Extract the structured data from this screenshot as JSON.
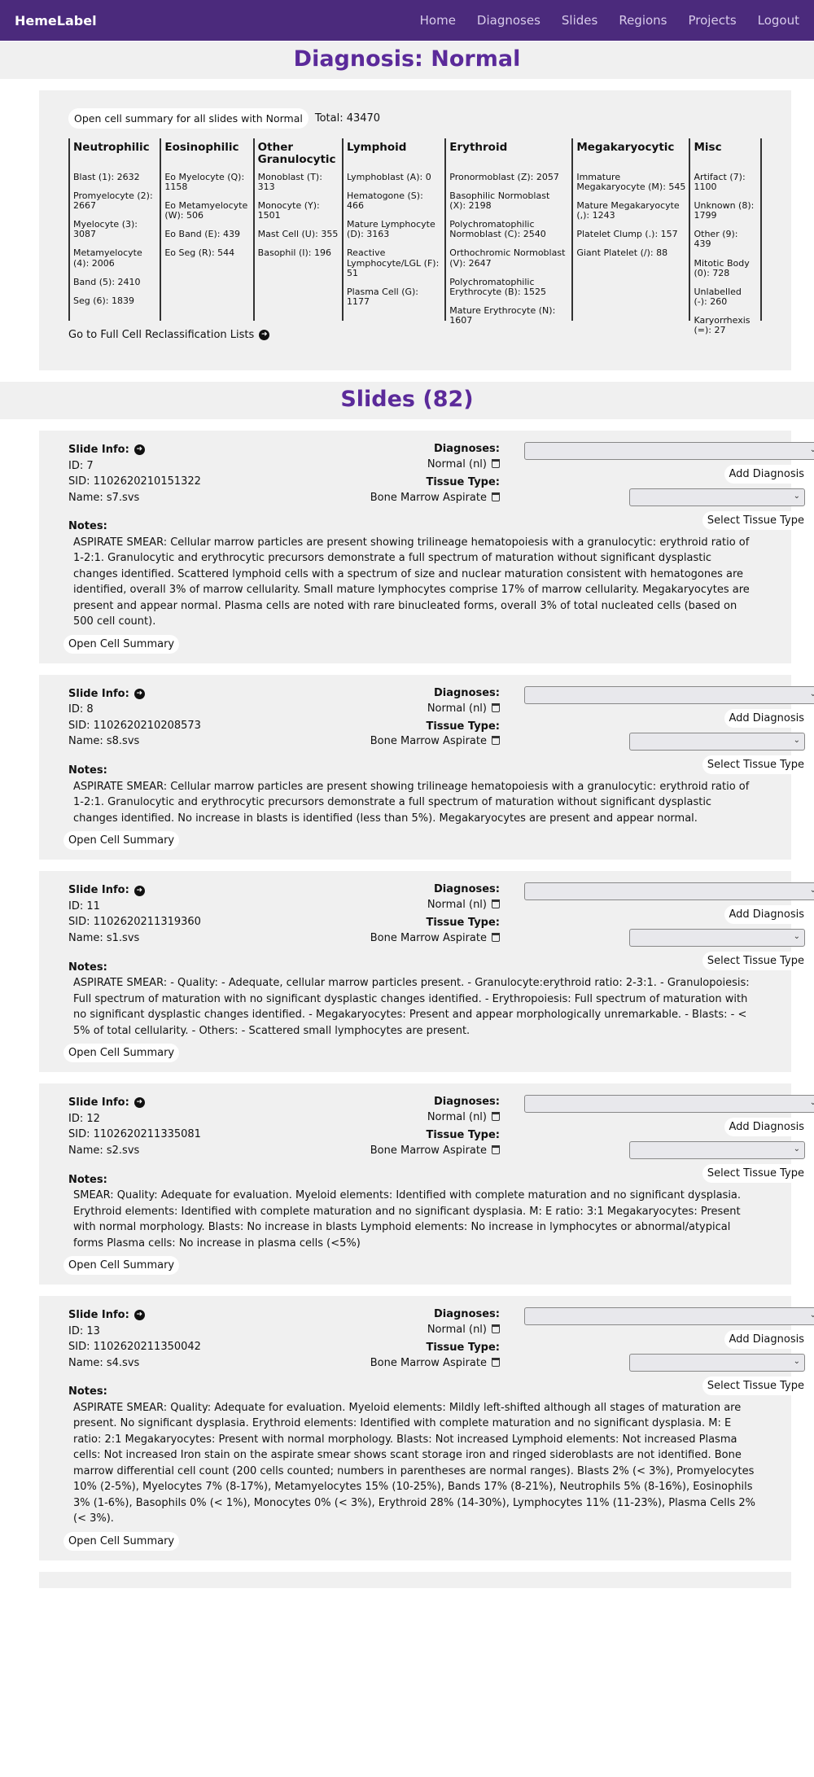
{
  "nav": {
    "brand": "HemeLabel",
    "links": [
      "Home",
      "Diagnoses",
      "Slides",
      "Regions",
      "Projects",
      "Logout"
    ]
  },
  "header": {
    "title": "Diagnosis: Normal"
  },
  "summary": {
    "open_button": "Open cell summary for all slides with Normal",
    "total": "Total: 43470",
    "columns": [
      {
        "title": "Neutrophilic",
        "items": [
          "Blast (1): 2632",
          "Promyelocyte (2): 2667",
          "Myelocyte (3): 3087",
          "Metamyelocyte (4): 2006",
          "Band (5): 2410",
          "Seg (6): 1839"
        ]
      },
      {
        "title": "Eosinophilic",
        "items": [
          "Eo Myelocyte (Q): 1158",
          "Eo Metamyelocyte (W): 506",
          "Eo Band (E): 439",
          "Eo Seg (R): 544"
        ]
      },
      {
        "title": "Other Granulocytic",
        "items": [
          "Monoblast (T): 313",
          "Monocyte (Y): 1501",
          "Mast Cell (U): 355",
          "Basophil (I): 196"
        ]
      },
      {
        "title": "Lymphoid",
        "items": [
          "Lymphoblast (A): 0",
          "Hematogone (S): 466",
          "Mature Lymphocyte (D): 3163",
          "Reactive Lymphocyte/LGL (F): 51",
          "Plasma Cell (G): 1177"
        ]
      },
      {
        "title": "Erythroid",
        "items": [
          "Pronormoblast (Z): 2057",
          "Basophilic Normoblast (X): 2198",
          "Polychromatophilic Normoblast (C): 2540",
          "Orthochromic Normoblast (V): 2647",
          "Polychromatophilic Erythrocyte (B): 1525",
          "Mature Erythrocyte (N): 1607"
        ]
      },
      {
        "title": "Megakaryocytic",
        "items": [
          "Immature Megakaryocyte (M): 545",
          "Mature Megakaryocyte (,): 1243",
          "Platelet Clump (.): 157",
          "Giant Platelet (/): 88"
        ]
      },
      {
        "title": "Misc",
        "items": [
          "Artifact (7): 1100",
          "Unknown (8): 1799",
          "Other (9): 439",
          "Mitotic Body (0): 728",
          "Unlabelled (-): 260",
          "Karyorrhexis (=): 27"
        ]
      }
    ],
    "full_link": "Go to Full Cell Reclassification Lists"
  },
  "slides_header": {
    "title": "Slides (82)"
  },
  "labels": {
    "slide_info": "Slide Info:",
    "diagnoses": "Diagnoses:",
    "tissue_type": "Tissue Type:",
    "add_diagnosis": "Add Diagnosis",
    "select_tissue": "Select Tissue Type",
    "notes": "Notes:",
    "open_cell_summary": "Open Cell Summary"
  },
  "slides": [
    {
      "id": "ID: 7",
      "sid": "SID: 1102620210151322",
      "name": "Name: s7.svs",
      "diagnosis": "Normal (nl)",
      "tissue": "Bone Marrow Aspirate",
      "notes": "ASPIRATE SMEAR: Cellular marrow particles are present showing trilineage hematopoiesis with a granulocytic: erythroid ratio of 1-2:1. Granulocytic and erythrocytic precursors demonstrate a full spectrum of maturation without significant dysplastic changes identified. Scattered lymphoid cells with a spectrum of size and nuclear maturation consistent with hematogones are identified, overall 3% of marrow cellularity. Small mature lymphocytes comprise 17% of marrow cellularity. Megakaryocytes are present and appear normal. Plasma cells are noted with rare binucleated forms, overall 3% of total nucleated cells (based on 500 cell count)."
    },
    {
      "id": "ID: 8",
      "sid": "SID: 1102620210208573",
      "name": "Name: s8.svs",
      "diagnosis": "Normal (nl)",
      "tissue": "Bone Marrow Aspirate",
      "notes": "ASPIRATE SMEAR: Cellular marrow particles are present showing trilineage hematopoiesis with a granulocytic: erythroid ratio of 1-2:1. Granulocytic and erythrocytic precursors demonstrate a full spectrum of maturation without significant dysplastic changes identified. No increase in blasts is identified (less than 5%). Megakaryocytes are present and appear normal."
    },
    {
      "id": "ID: 11",
      "sid": "SID: 1102620211319360",
      "name": "Name: s1.svs",
      "diagnosis": "Normal (nl)",
      "tissue": "Bone Marrow Aspirate",
      "notes": "ASPIRATE SMEAR: - Quality: - Adequate, cellular marrow particles present. - Granulocyte:erythroid ratio: 2-3:1. - Granulopoiesis: Full spectrum of maturation with no significant dysplastic changes identified. - Erythropoiesis: Full spectrum of maturation with no significant dysplastic changes identified. - Megakaryocytes: Present and appear morphologically unremarkable. - Blasts: - < 5% of total cellularity. - Others: - Scattered small lymphocytes are present."
    },
    {
      "id": "ID: 12",
      "sid": "SID: 1102620211335081",
      "name": "Name: s2.svs",
      "diagnosis": "Normal (nl)",
      "tissue": "Bone Marrow Aspirate",
      "notes": "SMEAR: Quality: Adequate for evaluation. Myeloid elements: Identified with complete maturation and no significant dysplasia. Erythroid elements: Identified with complete maturation and no significant dysplasia. M: E ratio: 3:1 Megakaryocytes: Present with normal morphology. Blasts: No increase in blasts Lymphoid elements: No increase in lymphocytes or abnormal/atypical forms Plasma cells: No increase in plasma cells (<5%)"
    },
    {
      "id": "ID: 13",
      "sid": "SID: 1102620211350042",
      "name": "Name: s4.svs",
      "diagnosis": "Normal (nl)",
      "tissue": "Bone Marrow Aspirate",
      "notes": "ASPIRATE SMEAR: Quality: Adequate for evaluation. Myeloid elements: Mildly left-shifted although all stages of maturation are present. No significant dysplasia. Erythroid elements: Identified with complete maturation and no significant dysplasia. M: E ratio: 2:1 Megakaryocytes: Present with normal morphology. Blasts: Not increased Lymphoid elements: Not increased Plasma cells: Not increased Iron stain on the aspirate smear shows scant storage iron and ringed sideroblasts are not identified. Bone marrow differential cell count (200 cells counted; numbers in parentheses are normal ranges). Blasts 2% (< 3%), Promyelocytes 10% (2-5%), Myelocytes 7% (8-17%), Metamyelocytes 15% (10-25%), Bands 17% (8-21%), Neutrophils 5% (8-16%), Eosinophils 3% (1-6%), Basophils 0% (< 1%), Monocytes 0% (< 3%), Erythroid 28% (14-30%), Lymphocytes 11% (11-23%), Plasma Cells 2% (< 3%)."
    }
  ]
}
